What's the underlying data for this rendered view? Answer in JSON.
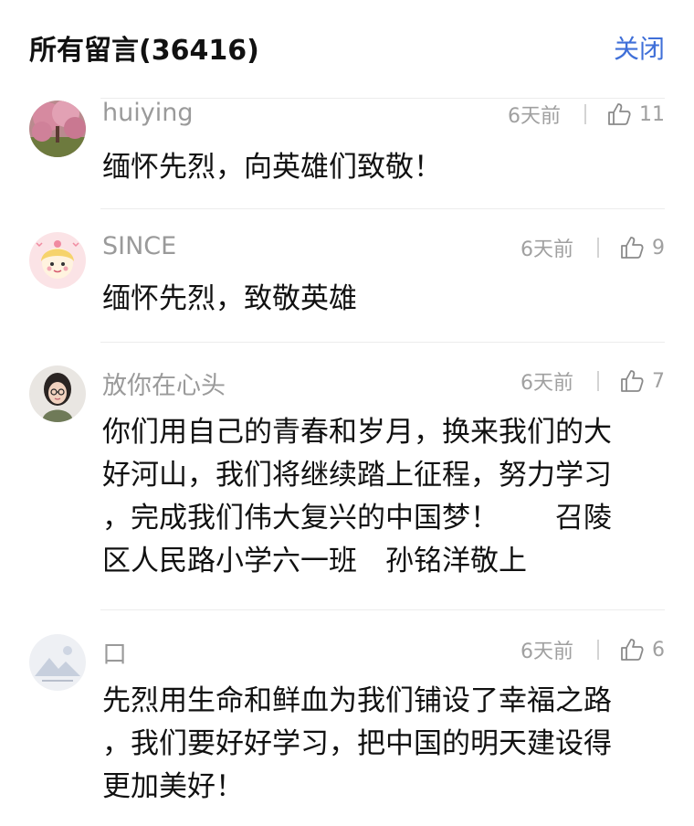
{
  "header": {
    "title": "所有留言(36416)",
    "close_label": "关闭"
  },
  "colors": {
    "accent": "#3f6fd8",
    "muted": "#9a9a9a",
    "text": "#111111"
  },
  "comments": [
    {
      "username": "huiying",
      "time": "6天前",
      "likes": "11",
      "avatar_icon": "cherry-blossom-photo-icon",
      "lines": [
        "缅怀先烈，向英雄们致敬！"
      ]
    },
    {
      "username": "SINCE",
      "time": "6天前",
      "likes": "9",
      "avatar_icon": "cartoon-girl-icon",
      "lines": [
        "缅怀先烈，致敬英雄"
      ]
    },
    {
      "username": "放你在心头",
      "time": "6天前",
      "likes": "7",
      "avatar_icon": "girl-with-glasses-icon",
      "lines": [
        "你们用自己的青春和岁月，换来我们的大",
        "好河山，我们将继续踏上征程，努力学习",
        "，完成我们伟大复兴的中国梦！　　召陵",
        "区人民路小学六一班　孙铭洋敬上"
      ]
    },
    {
      "username": "口",
      "time": "6天前",
      "likes": "6",
      "avatar_icon": "mountain-landscape-icon",
      "lines": [
        "先烈用生命和鲜血为我们铺设了幸福之路",
        "，我们要好好学习，把中国的明天建设得",
        "更加美好！"
      ]
    }
  ]
}
